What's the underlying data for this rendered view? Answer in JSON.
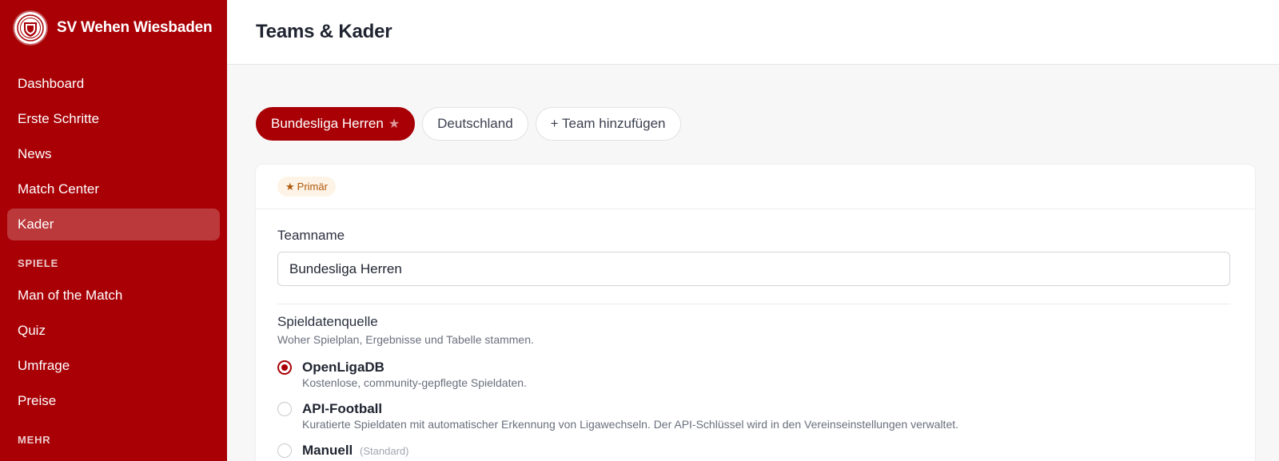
{
  "sidebar": {
    "brand_name": "SV Wehen Wiesbaden",
    "logo_icon": "club-crest-icon",
    "items": [
      {
        "label": "Dashboard"
      },
      {
        "label": "Erste Schritte"
      },
      {
        "label": "News"
      },
      {
        "label": "Match Center"
      },
      {
        "label": "Kader",
        "active": true
      }
    ],
    "section_spiele": "SPIELE",
    "spiele_items": [
      {
        "label": "Man of the Match"
      },
      {
        "label": "Quiz"
      },
      {
        "label": "Umfrage"
      },
      {
        "label": "Preise"
      }
    ],
    "section_mehr": "MEHR"
  },
  "header": {
    "title": "Teams & Kader"
  },
  "tabs": [
    {
      "label": "Bundesliga Herren",
      "active": true,
      "icon": "star-icon"
    },
    {
      "label": "Deutschland",
      "active": false
    },
    {
      "label": "+ Team hinzufügen",
      "active": false
    }
  ],
  "team": {
    "badge": "Primär",
    "badge_icon": "star-icon",
    "name_label": "Teamname",
    "name_value": "Bundesliga Herren",
    "source_label": "Spieldatenquelle",
    "source_help": "Woher Spielplan, Ergebnisse und Tabelle stammen.",
    "options": [
      {
        "title": "OpenLigaDB",
        "desc": "Kostenlose, community-gepflegte Spieldaten.",
        "checked": true
      },
      {
        "title": "API-Football",
        "desc": "Kuratierte Spieldaten mit automatischer Erkennung von Ligawechseln. Der API-Schlüssel wird in den Vereinseinstellungen verwaltet.",
        "checked": false
      },
      {
        "title": "Manuell",
        "hint": "(Standard)",
        "checked": false
      }
    ]
  },
  "colors": {
    "brand_red": "#a80005",
    "badge_bg": "#fdf3e6",
    "badge_text": "#b0580a"
  }
}
